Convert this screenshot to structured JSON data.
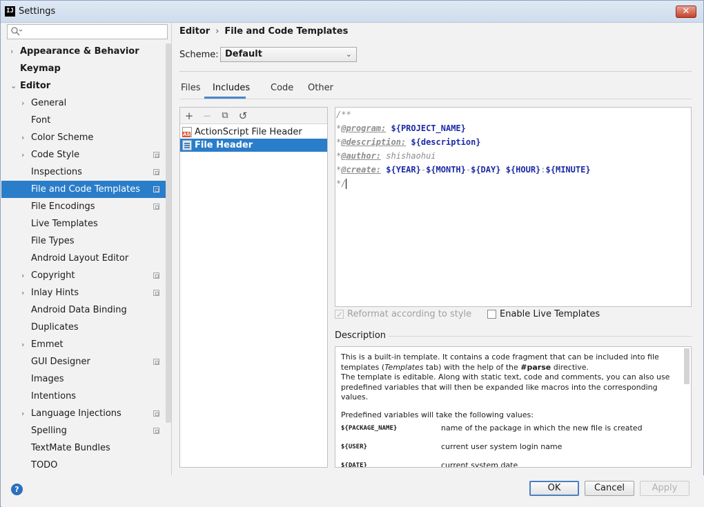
{
  "window": {
    "title": "Settings",
    "close_symbol": "✕",
    "app_icon_text": "IJ"
  },
  "search": {
    "placeholder": ""
  },
  "sidebar": {
    "items": [
      {
        "label": "Appearance & Behavior",
        "chevron": "›",
        "bold": true
      },
      {
        "label": "Keymap",
        "chevron": "",
        "bold": true
      },
      {
        "label": "Editor",
        "chevron": "⌄",
        "bold": true
      },
      {
        "label": "General",
        "chevron": "›"
      },
      {
        "label": "Font",
        "chevron": ""
      },
      {
        "label": "Color Scheme",
        "chevron": "›"
      },
      {
        "label": "Code Style",
        "chevron": "›",
        "project": true
      },
      {
        "label": "Inspections",
        "chevron": "",
        "project": true
      },
      {
        "label": "File and Code Templates",
        "chevron": "",
        "project": true,
        "selected": true
      },
      {
        "label": "File Encodings",
        "chevron": "",
        "project": true
      },
      {
        "label": "Live Templates",
        "chevron": ""
      },
      {
        "label": "File Types",
        "chevron": ""
      },
      {
        "label": "Android Layout Editor",
        "chevron": ""
      },
      {
        "label": "Copyright",
        "chevron": "›",
        "project": true
      },
      {
        "label": "Inlay Hints",
        "chevron": "›",
        "project": true
      },
      {
        "label": "Android Data Binding",
        "chevron": ""
      },
      {
        "label": "Duplicates",
        "chevron": ""
      },
      {
        "label": "Emmet",
        "chevron": "›"
      },
      {
        "label": "GUI Designer",
        "chevron": "",
        "project": true
      },
      {
        "label": "Images",
        "chevron": ""
      },
      {
        "label": "Intentions",
        "chevron": ""
      },
      {
        "label": "Language Injections",
        "chevron": "›",
        "project": true
      },
      {
        "label": "Spelling",
        "chevron": "",
        "project": true
      },
      {
        "label": "TextMate Bundles",
        "chevron": ""
      },
      {
        "label": "TODO",
        "chevron": ""
      }
    ]
  },
  "breadcrumb": {
    "parent": "Editor",
    "separator": "›",
    "current": "File and Code Templates"
  },
  "scheme": {
    "label": "Scheme:",
    "value": "Default",
    "caret": "⌄"
  },
  "tabs": [
    "Files",
    "Includes",
    "Code",
    "Other"
  ],
  "active_tab": "Includes",
  "list_toolbar": {
    "add": "+",
    "remove": "−",
    "copy": "⧉",
    "reset": "↺"
  },
  "templates": [
    {
      "name": "ActionScript File Header",
      "icon_text": "AS"
    },
    {
      "name": "File Header",
      "selected": true
    }
  ],
  "editor": {
    "line1": "/**",
    "line2_star": "*",
    "line2_tag": "@program:",
    "line2_var": "${PROJECT_NAME}",
    "line3_star": "*",
    "line3_tag": "@description:",
    "line3_var": "${description}",
    "line4_star": "*",
    "line4_tag": "@author:",
    "line4_text": "shishaohui",
    "line5_star": "*",
    "line5_tag": "@create:",
    "line5_year": "${YEAR}",
    "line5_dash1": "-",
    "line5_month": "${MONTH}",
    "line5_dash2": "-",
    "line5_day": "${DAY}",
    "line5_hour": "${HOUR}",
    "line5_colon": ":",
    "line5_minute": "${MINUTE}",
    "line6": "*/"
  },
  "options": {
    "reformat_label": "Reformat according to style",
    "reformat_checked": true,
    "live_templates_label": "Enable Live Templates",
    "live_templates_checked": false
  },
  "description": {
    "title": "Description",
    "p1_a": "This is a built-in template. It contains a code fragment that can be included into file templates (",
    "p1_em": "Templates",
    "p1_b": " tab) with the help of the ",
    "p1_strong": "#parse",
    "p1_c": " directive.",
    "p2": "The template is editable. Along with static text, code and comments, you can also use predefined variables that will then be expanded like macros into the corresponding values.",
    "p3": "Predefined variables will take the following values:",
    "variables": [
      {
        "name": "${PACKAGE_NAME}",
        "desc": "name of the package in which the new file is created"
      },
      {
        "name": "${USER}",
        "desc": "current user system login name"
      },
      {
        "name": "${DATE}",
        "desc": "current system date"
      }
    ]
  },
  "footer": {
    "help": "?",
    "ok": "OK",
    "cancel": "Cancel",
    "apply": "Apply"
  }
}
